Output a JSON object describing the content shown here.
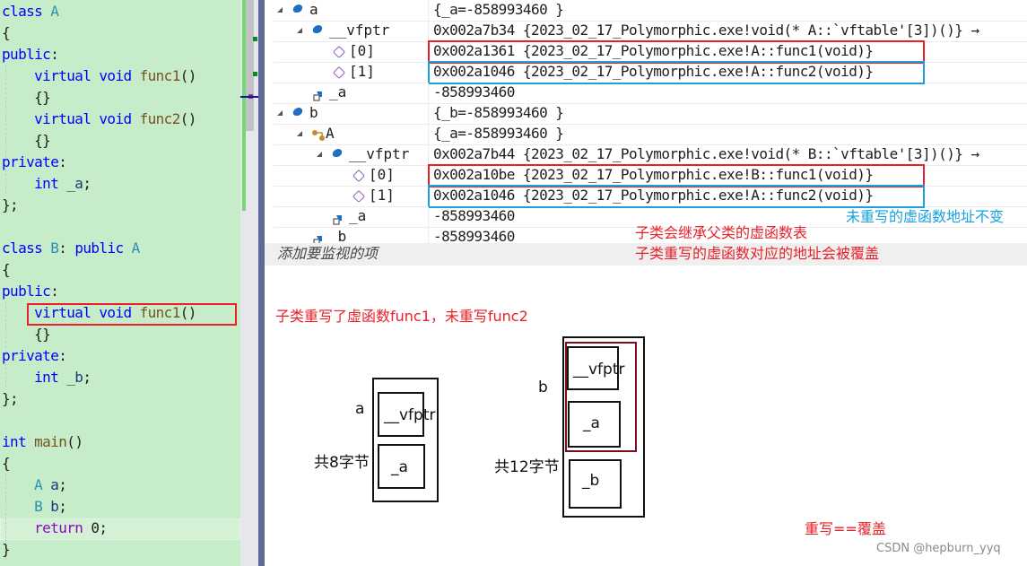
{
  "editor": {
    "lines": [
      {
        "tokens": [
          {
            "t": "class ",
            "c": "kw"
          },
          {
            "t": "A",
            "c": "ty"
          }
        ]
      },
      {
        "tokens": [
          {
            "t": "{",
            "c": ""
          }
        ]
      },
      {
        "tokens": [
          {
            "t": "public",
            "c": "kw"
          },
          {
            "t": ":",
            "c": ""
          }
        ]
      },
      {
        "tokens": [
          {
            "t": "    virtual void ",
            "c": "kw"
          },
          {
            "t": "func1",
            "c": "fn"
          },
          {
            "t": "()",
            "c": ""
          }
        ]
      },
      {
        "tokens": [
          {
            "t": "    {}",
            "c": ""
          }
        ]
      },
      {
        "tokens": [
          {
            "t": "    virtual void ",
            "c": "kw"
          },
          {
            "t": "func2",
            "c": "fn"
          },
          {
            "t": "()",
            "c": ""
          }
        ]
      },
      {
        "tokens": [
          {
            "t": "    {}",
            "c": ""
          }
        ]
      },
      {
        "tokens": [
          {
            "t": "private",
            "c": "kw"
          },
          {
            "t": ":",
            "c": ""
          }
        ]
      },
      {
        "tokens": [
          {
            "t": "    int ",
            "c": "kw"
          },
          {
            "t": "_a",
            "c": "id"
          },
          {
            "t": ";",
            "c": ""
          }
        ]
      },
      {
        "tokens": [
          {
            "t": "};",
            "c": ""
          }
        ]
      },
      {
        "tokens": []
      },
      {
        "tokens": [
          {
            "t": "class ",
            "c": "kw"
          },
          {
            "t": "B",
            "c": "ty"
          },
          {
            "t": ": ",
            "c": ""
          },
          {
            "t": "public ",
            "c": "kw"
          },
          {
            "t": "A",
            "c": "ty"
          }
        ]
      },
      {
        "tokens": [
          {
            "t": "{",
            "c": ""
          }
        ]
      },
      {
        "tokens": [
          {
            "t": "public",
            "c": "kw"
          },
          {
            "t": ":",
            "c": ""
          }
        ]
      },
      {
        "tokens": [
          {
            "t": "    virtual void ",
            "c": "kw"
          },
          {
            "t": "func1",
            "c": "fn"
          },
          {
            "t": "()",
            "c": ""
          }
        ]
      },
      {
        "tokens": [
          {
            "t": "    {}",
            "c": ""
          }
        ]
      },
      {
        "tokens": [
          {
            "t": "private",
            "c": "kw"
          },
          {
            "t": ":",
            "c": ""
          }
        ]
      },
      {
        "tokens": [
          {
            "t": "    int ",
            "c": "kw"
          },
          {
            "t": "_b",
            "c": "id"
          },
          {
            "t": ";",
            "c": ""
          }
        ]
      },
      {
        "tokens": [
          {
            "t": "};",
            "c": ""
          }
        ]
      },
      {
        "tokens": []
      },
      {
        "tokens": [
          {
            "t": "int ",
            "c": "kw"
          },
          {
            "t": "main",
            "c": "fn"
          },
          {
            "t": "()",
            "c": ""
          }
        ]
      },
      {
        "tokens": [
          {
            "t": "{",
            "c": ""
          }
        ]
      },
      {
        "tokens": [
          {
            "t": "    ",
            "c": ""
          },
          {
            "t": "A",
            "c": "ty"
          },
          {
            "t": " ",
            "c": ""
          },
          {
            "t": "a",
            "c": "id"
          },
          {
            "t": ";",
            "c": ""
          }
        ]
      },
      {
        "tokens": [
          {
            "t": "    ",
            "c": ""
          },
          {
            "t": "B",
            "c": "ty"
          },
          {
            "t": " ",
            "c": ""
          },
          {
            "t": "b",
            "c": "id"
          },
          {
            "t": ";",
            "c": ""
          }
        ]
      },
      {
        "tokens": [
          {
            "t": "    return ",
            "c": "ctl"
          },
          {
            "t": "0;",
            "c": ""
          }
        ]
      },
      {
        "tokens": [
          {
            "t": "}",
            "c": ""
          }
        ]
      }
    ]
  },
  "watch": {
    "rows": [
      {
        "name": "a",
        "icon": "object",
        "expanded": true,
        "depth": 0,
        "value": "{_a=-858993460 }"
      },
      {
        "name": "__vfptr",
        "icon": "object",
        "expanded": true,
        "depth": 1,
        "value": "0x002a7b34 {2023_02_17_Polymorphic.exe!void(* A::`vftable'[3])()} →"
      },
      {
        "name": "[0]",
        "icon": "method",
        "depth": 2,
        "value": "0x002a1361 {2023_02_17_Polymorphic.exe!A::func1(void)}",
        "highlight": "red"
      },
      {
        "name": "[1]",
        "icon": "method",
        "depth": 2,
        "value": "0x002a1046 {2023_02_17_Polymorphic.exe!A::func2(void)}",
        "highlight": "blue"
      },
      {
        "name": "_a",
        "icon": "field",
        "depth": 1,
        "value": "-858993460"
      },
      {
        "name": "b",
        "icon": "object",
        "expanded": true,
        "depth": 0,
        "value": "{_b=-858993460 }"
      },
      {
        "name": "A",
        "icon": "base",
        "expanded": true,
        "depth": 1,
        "value": "{_a=-858993460 }"
      },
      {
        "name": "__vfptr",
        "icon": "object",
        "expanded": true,
        "depth": 2,
        "value": "0x002a7b44 {2023_02_17_Polymorphic.exe!void(* B::`vftable'[3])()} →"
      },
      {
        "name": "[0]",
        "icon": "method",
        "depth": 3,
        "value": "0x002a10be {2023_02_17_Polymorphic.exe!B::func1(void)}",
        "highlight": "red"
      },
      {
        "name": "[1]",
        "icon": "method",
        "depth": 3,
        "value": "0x002a1046 {2023_02_17_Polymorphic.exe!A::func2(void)}",
        "highlight": "blue"
      },
      {
        "name": "_a",
        "icon": "field",
        "depth": 2,
        "value": "-858993460"
      },
      {
        "name": "_b",
        "icon": "field",
        "depth": 1,
        "value": "-858993460"
      }
    ],
    "add_watch_placeholder": "添加要监视的项"
  },
  "annotations": {
    "unchanged_address": "未重写的虚函数地址不变",
    "inherit_vtable": "子类会继承父类的虚函数表",
    "override_address": "子类重写的虚函数对应的地址会被覆盖",
    "override_summary": "子类重写了虚函数func1，未重写func2",
    "override_equals": "重写==覆盖"
  },
  "diagram": {
    "a": {
      "label": "a",
      "size": "共8字节",
      "fields": [
        "__vfptr",
        "_a"
      ]
    },
    "b": {
      "label": "b",
      "size": "共12字节",
      "fields": [
        "__vfptr",
        "_a",
        "_b"
      ]
    }
  },
  "watermark": "CSDN @hepburn_yyq"
}
